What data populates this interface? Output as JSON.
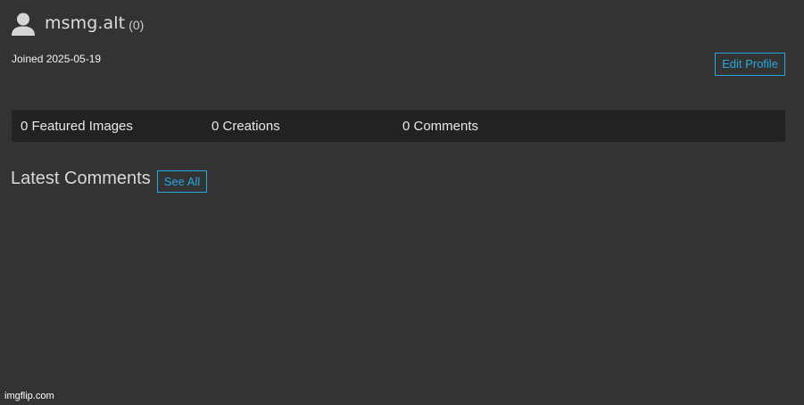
{
  "profile": {
    "avatar_icon": "user-silhouette-icon",
    "username": "msmg.alt",
    "points": "(0)",
    "joined": "Joined 2025-05-19",
    "edit_label": "Edit Profile"
  },
  "stats": [
    {
      "label": "0 Featured Images"
    },
    {
      "label": "0 Creations"
    },
    {
      "label": "0 Comments"
    }
  ],
  "latest_comments": {
    "heading": "Latest Comments",
    "see_all_label": "See All"
  },
  "watermark": "imgflip.com",
  "colors": {
    "background": "#333333",
    "stats_bar": "#222222",
    "accent": "#29a8e0"
  }
}
